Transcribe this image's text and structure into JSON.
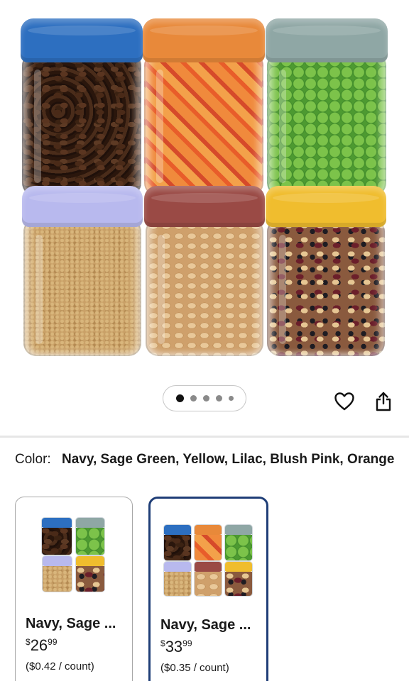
{
  "product_image": {
    "jars": [
      {
        "lid": "navy",
        "lid_color": "#2d6fc0",
        "contents": "coffee beans"
      },
      {
        "lid": "orange",
        "lid_color": "#e8893a",
        "contents": "diced vegetables"
      },
      {
        "lid": "sage green",
        "lid_color": "#8fa7a5",
        "contents": "green peas"
      },
      {
        "lid": "lilac",
        "lid_color": "#b8b9ee",
        "contents": "buckwheat"
      },
      {
        "lid": "blush pink",
        "lid_color": "#9a4a45",
        "contents": "oats"
      },
      {
        "lid": "yellow",
        "lid_color": "#f0bd2e",
        "contents": "mixed beans"
      }
    ]
  },
  "carousel": {
    "dot_count": 5,
    "active_index": 0
  },
  "actions": {
    "favorite_icon": "heart-icon",
    "share_icon": "share-icon"
  },
  "color": {
    "label": "Color:",
    "value": "Navy, Sage Green, Yellow, Lilac, Blush Pink, Orange"
  },
  "options": [
    {
      "title": "Navy, Sage ...",
      "price_currency": "$",
      "price_whole": "26",
      "price_cents": "99",
      "unit_price": "($0.42 / count)",
      "selected": false,
      "thumb_jar_count": 4
    },
    {
      "title": "Navy, Sage ...",
      "price_currency": "$",
      "price_whole": "33",
      "price_cents": "99",
      "unit_price": "($0.35 / count)",
      "selected": true,
      "thumb_jar_count": 6
    }
  ],
  "colors": {
    "selected_border": "#1f3e77",
    "divider": "#e6e6e6"
  }
}
